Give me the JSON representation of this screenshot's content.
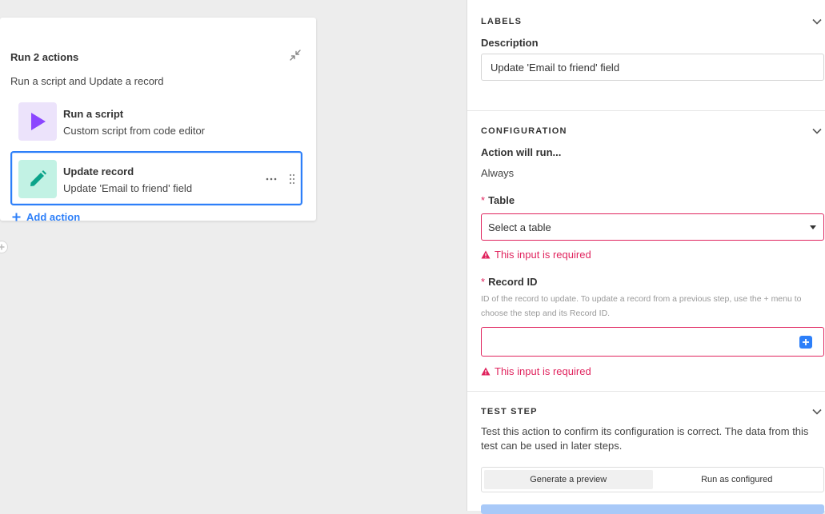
{
  "card": {
    "title": "Run 2 actions",
    "subtitle": "Run a script and Update a record",
    "actions": [
      {
        "title": "Run a script",
        "subtitle": "Custom script from code editor",
        "icon": "play-icon",
        "color": "#8b46ff"
      },
      {
        "title": "Update record",
        "subtitle": "Update 'Email to friend' field",
        "icon": "pencil-icon",
        "color": "#0ba48a"
      }
    ],
    "add_action_label": "Add action"
  },
  "labels_section": {
    "header": "LABELS",
    "description_label": "Description",
    "description_value": "Update 'Email to friend' field"
  },
  "configuration": {
    "header": "CONFIGURATION",
    "action_will_run_label": "Action will run...",
    "action_will_run_value": "Always",
    "table_label": "Table",
    "table_placeholder": "Select a table",
    "table_error": "This input is required",
    "record_id_label": "Record ID",
    "record_id_help": "ID of the record to update. To update a record from a previous step, use the + menu to choose the step and its Record ID.",
    "record_id_error": "This input is required",
    "required_marker": "*"
  },
  "test_step": {
    "header": "TEST STEP",
    "description": "Test this action to confirm its configuration is correct. The data from this test can be used in later steps.",
    "tabs": [
      "Generate a preview",
      "Run as configured"
    ]
  },
  "colors": {
    "accent": "#2d7ff9",
    "error": "#e0245e"
  }
}
